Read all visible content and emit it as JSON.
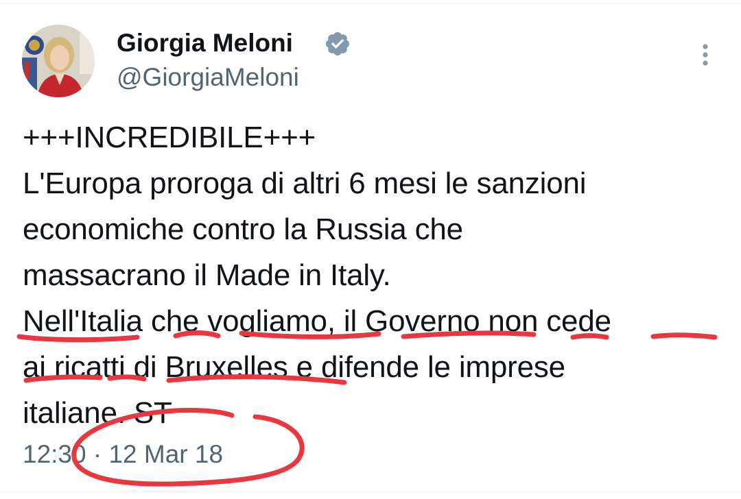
{
  "author": {
    "display_name": "Giorgia Meloni",
    "handle": "@GiorgiaMeloni",
    "verified": true,
    "avatar_icon": "profile-photo"
  },
  "tweet": {
    "lines": [
      "+++INCREDIBILE+++",
      "L'Europa proroga di altri 6 mesi le sanzioni",
      "economiche contro la Russia che",
      "massacrano il Made in Italy.",
      "Nell'Italia che vogliamo, il Governo non cede",
      "ai ricatti di Bruxelles e difende le imprese",
      "italiane. ST"
    ],
    "timestamp": "12:30 · 12 Mar 18"
  },
  "menu": {
    "icon": "more-vertical-icon"
  },
  "annotations": {
    "color": "#e8373f",
    "underline": "dashed red underline under lines 5–6",
    "circle": "red hand-drawn circle around the timestamp"
  },
  "colors": {
    "text_primary": "#0f1419",
    "text_secondary": "#536471",
    "verified_badge": "#829aab",
    "annotation_red": "#e8373f"
  }
}
